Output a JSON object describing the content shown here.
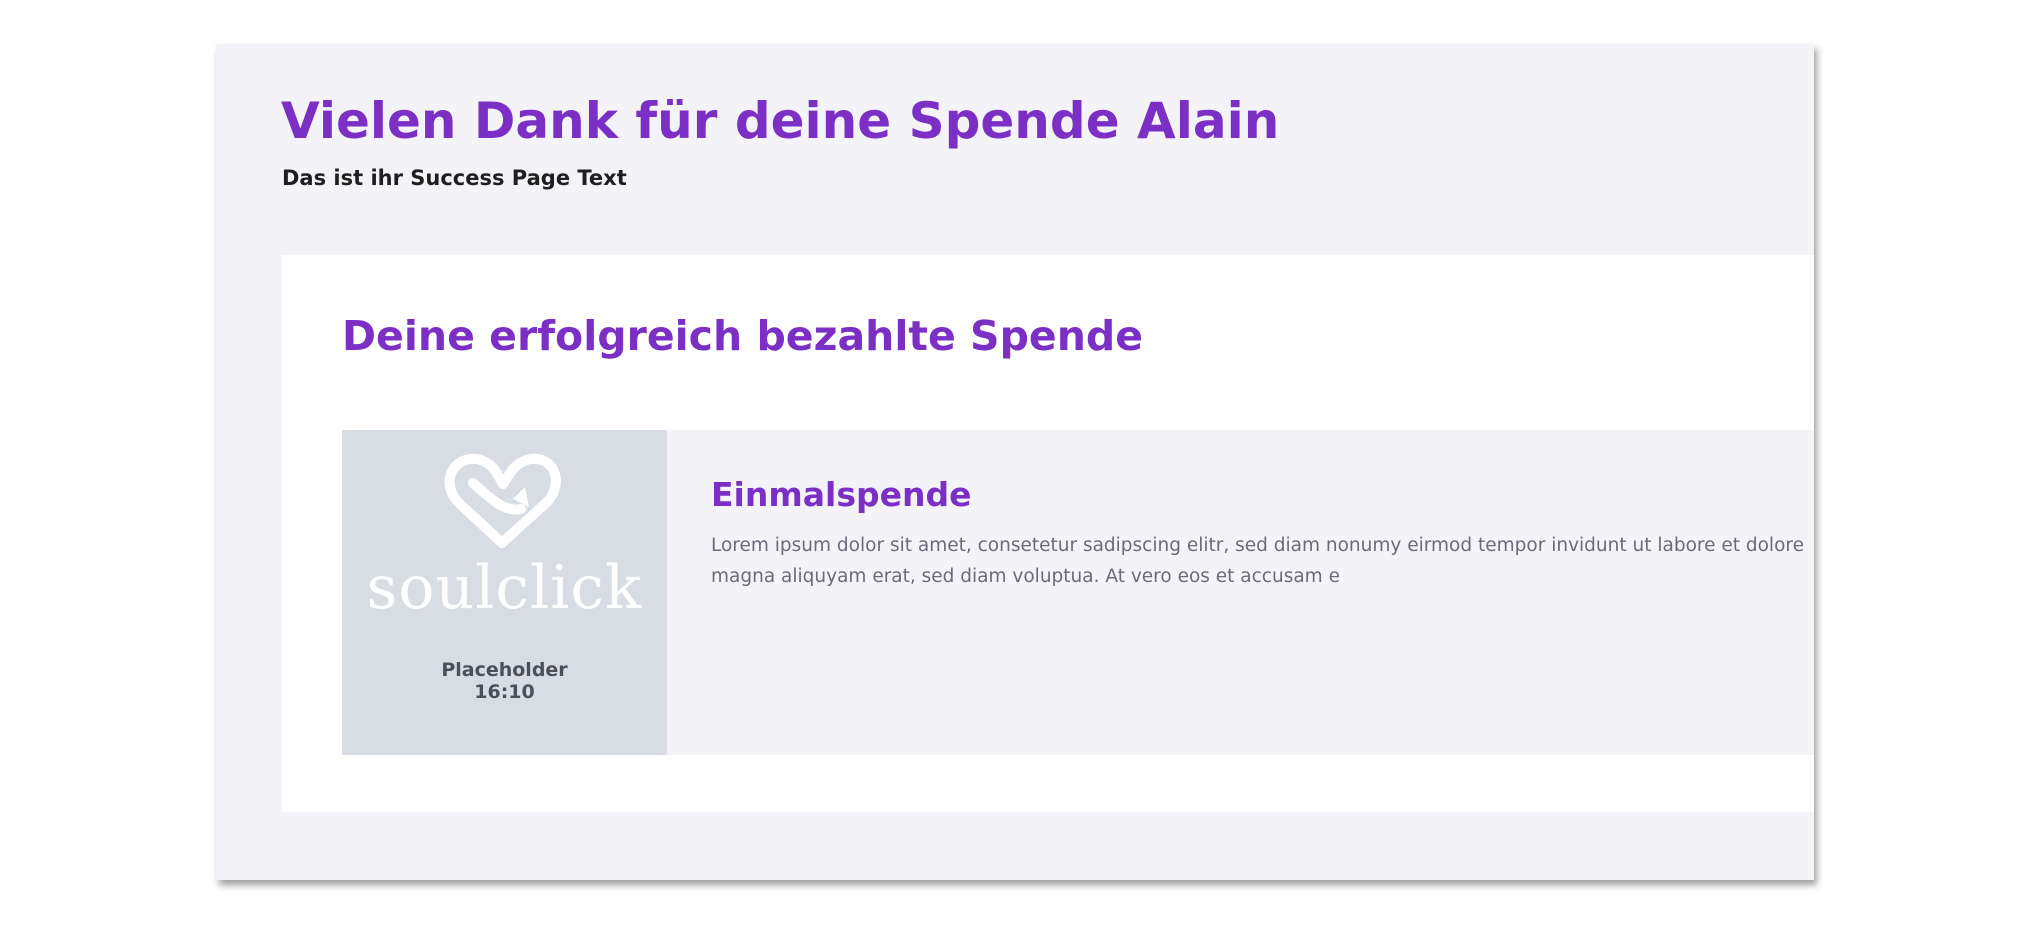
{
  "header": {
    "title": "Vielen Dank für deine Spende Alain",
    "subtitle": "Das ist ihr Success Page Text"
  },
  "card": {
    "title": "Deine erfolgreich bezahlte Spende",
    "donation": {
      "image": {
        "logo_text": "soulclick",
        "placeholder_label": "Placeholder",
        "placeholder_ratio": "16:10"
      },
      "type": "Einmalspende",
      "description": "Lorem ipsum dolor sit amet, consetetur sadipscing elitr, sed diam nonumy eirmod tempor invidunt ut labore et dolore magna aliquyam erat, sed diam voluptua. At vero eos et accusam e"
    }
  },
  "colors": {
    "accent": "#7b2fc4",
    "page_background": "#f4f3f8",
    "card_background": "#ffffff",
    "placeholder_background": "#d8dce3"
  }
}
